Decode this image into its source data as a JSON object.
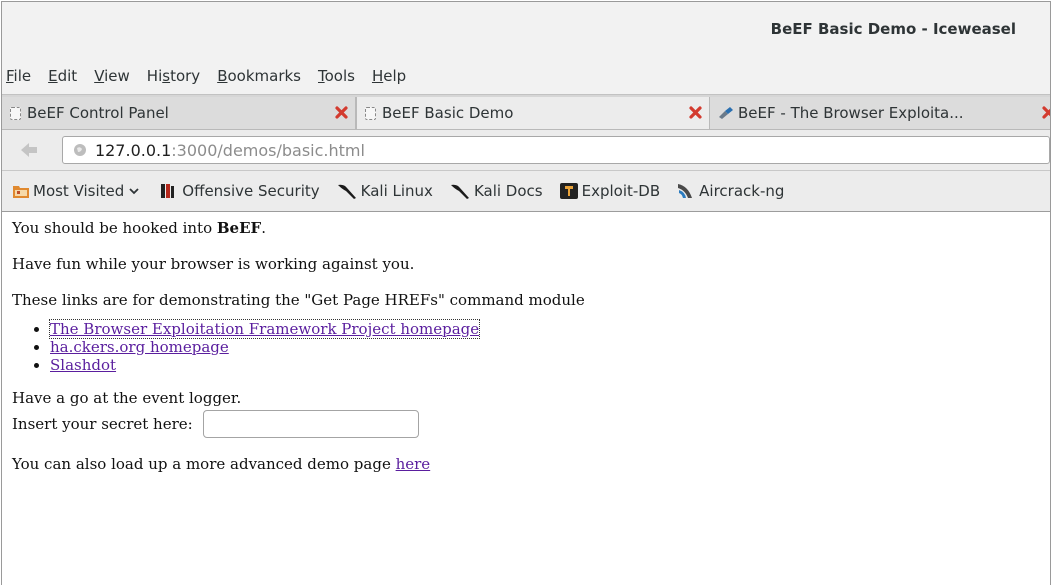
{
  "window": {
    "title": "BeEF Basic Demo - Iceweasel"
  },
  "menu": [
    {
      "pre": "",
      "accel": "F",
      "post": "ile"
    },
    {
      "pre": "",
      "accel": "E",
      "post": "dit"
    },
    {
      "pre": "",
      "accel": "V",
      "post": "iew"
    },
    {
      "pre": "Hi",
      "accel": "s",
      "post": "tory"
    },
    {
      "pre": "",
      "accel": "B",
      "post": "ookmarks"
    },
    {
      "pre": "",
      "accel": "T",
      "post": "ools"
    },
    {
      "pre": "",
      "accel": "H",
      "post": "elp"
    }
  ],
  "tabs": [
    {
      "label": "BeEF Control Panel",
      "active": false
    },
    {
      "label": "BeEF Basic Demo",
      "active": true
    },
    {
      "label": "BeEF - The Browser Exploita...",
      "active": false
    }
  ],
  "address": {
    "host": "127.0.0.1",
    "path": ":3000/demos/basic.html"
  },
  "bookmarks": [
    {
      "label": "Most Visited",
      "icon": "folder-icon"
    },
    {
      "label": "Offensive Security",
      "icon": "offsec-icon"
    },
    {
      "label": "Kali Linux",
      "icon": "kali-dragon-icon"
    },
    {
      "label": "Kali Docs",
      "icon": "kali-dragon-icon"
    },
    {
      "label": "Exploit-DB",
      "icon": "exploitdb-icon"
    },
    {
      "label": "Aircrack-ng",
      "icon": "aircrack-icon"
    }
  ],
  "page": {
    "hooked_pre": "You should be hooked into ",
    "hooked_bold": "BeEF",
    "hooked_post": ".",
    "fun": "Have fun while your browser is working against you.",
    "links_intro": "These links are for demonstrating the \"Get Page HREFs\" command module",
    "links": [
      "The Browser Exploitation Framework Project homepage",
      "ha.ckers.org homepage",
      "Slashdot"
    ],
    "event_logger": "Have a go at the event logger.",
    "secret_label": "Insert your secret here:",
    "secret_value": "",
    "advanced_pre": "You can also load up a more advanced demo page ",
    "advanced_link": "here"
  },
  "colors": {
    "link": "#5a1e9e",
    "close_red": "#d33b2f"
  }
}
